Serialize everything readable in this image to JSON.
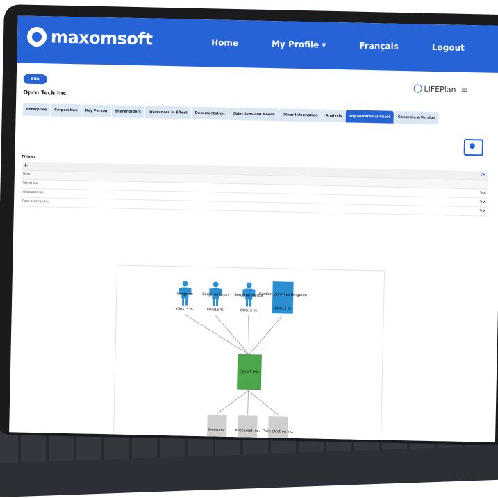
{
  "brand": {
    "name": "maxomsoft",
    "accent": "#2563d7"
  },
  "nav": {
    "links": [
      "Home",
      "My Profile ▾",
      "Français",
      "Logout"
    ]
  },
  "header": {
    "pill": "BNA",
    "company": "Opco Tech Inc.",
    "product": "LIFEPlan"
  },
  "tabs": [
    {
      "label": "Enterprise"
    },
    {
      "label": "Corporation"
    },
    {
      "label": "Key Person"
    },
    {
      "label": "Shareholders"
    },
    {
      "label": "Insurances in Effect"
    },
    {
      "label": "Documentation"
    },
    {
      "label": "Objectives and Needs"
    },
    {
      "label": "Other Information"
    },
    {
      "label": "Analysis"
    },
    {
      "label": "Organizational Chart",
      "active": true
    },
    {
      "label": "Generate a Version"
    }
  ],
  "filiales": {
    "title": "Filiales",
    "add_label": "+",
    "column": "Nom",
    "rows": [
      "TechO Inc.",
      "Absolunet Inc.",
      "Puce electron Inc."
    ],
    "row_actions": "✎✕"
  },
  "orgchart": {
    "shareholders": [
      {
        "name": "Bergeron",
        "pct": "OKG15 %"
      },
      {
        "name": "Bergeron Lepin",
        "pct": "OKG15 %"
      },
      {
        "name": "Bergeron Valleur",
        "pct": "OKG15 %"
      },
      {
        "name": "Gestion Jean-Yves Bergeron",
        "pct": "OKG15 %"
      }
    ],
    "parent": {
      "name": "Opco T Inc."
    },
    "subsidiaries": [
      "TechO Inc.",
      "Absolunet Inc.",
      "Puce electron Inc."
    ]
  }
}
